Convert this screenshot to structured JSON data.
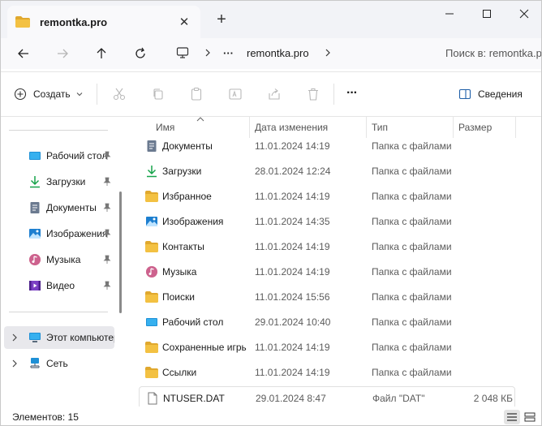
{
  "tab": {
    "title": "remontka.pro",
    "close": "✕"
  },
  "new_tab": "+",
  "window_controls": {
    "minimize": "—",
    "maximize": "☐",
    "close": "✕"
  },
  "breadcrumb": {
    "ellipsis": "···",
    "current": "remontka.pro"
  },
  "search": {
    "placeholder": "Поиск в: remontka.pro"
  },
  "toolbar": {
    "create_label": "Создать",
    "more": "···",
    "details_label": "Сведения"
  },
  "sidebar": {
    "pinned": [
      {
        "label": "Рабочий стол",
        "icon": "desktop-icon"
      },
      {
        "label": "Загрузки",
        "icon": "download-icon"
      },
      {
        "label": "Документы",
        "icon": "documents-icon"
      },
      {
        "label": "Изображения",
        "icon": "pictures-icon"
      },
      {
        "label": "Музыка",
        "icon": "music-icon"
      },
      {
        "label": "Видео",
        "icon": "video-icon"
      }
    ],
    "tree": [
      {
        "label": "Этот компьютер",
        "icon": "this-pc-icon"
      },
      {
        "label": "Сеть",
        "icon": "network-icon"
      }
    ]
  },
  "columns": {
    "name": "Имя",
    "date": "Дата изменения",
    "type": "Тип",
    "size": "Размер"
  },
  "files": [
    {
      "name": "Документы",
      "date": "11.01.2024 14:19",
      "type": "Папка с файлами",
      "size": "",
      "icon": "documents-icon"
    },
    {
      "name": "Загрузки",
      "date": "28.01.2024 12:24",
      "type": "Папка с файлами",
      "size": "",
      "icon": "download-icon"
    },
    {
      "name": "Избранное",
      "date": "11.01.2024 14:19",
      "type": "Папка с файлами",
      "size": "",
      "icon": "folder-icon"
    },
    {
      "name": "Изображения",
      "date": "11.01.2024 14:35",
      "type": "Папка с файлами",
      "size": "",
      "icon": "pictures-icon"
    },
    {
      "name": "Контакты",
      "date": "11.01.2024 14:19",
      "type": "Папка с файлами",
      "size": "",
      "icon": "folder-icon"
    },
    {
      "name": "Музыка",
      "date": "11.01.2024 14:19",
      "type": "Папка с файлами",
      "size": "",
      "icon": "music-icon"
    },
    {
      "name": "Поиски",
      "date": "11.01.2024 15:56",
      "type": "Папка с файлами",
      "size": "",
      "icon": "folder-icon"
    },
    {
      "name": "Рабочий стол",
      "date": "29.01.2024 10:40",
      "type": "Папка с файлами",
      "size": "",
      "icon": "desktop-icon"
    },
    {
      "name": "Сохраненные игры",
      "date": "11.01.2024 14:19",
      "type": "Папка с файлами",
      "size": "",
      "icon": "folder-icon"
    },
    {
      "name": "Ссылки",
      "date": "11.01.2024 14:19",
      "type": "Папка с файлами",
      "size": "",
      "icon": "folder-icon"
    },
    {
      "name": "NTUSER.DAT",
      "date": "29.01.2024 8:47",
      "type": "Файл \"DAT\"",
      "size": "2 048 КБ",
      "icon": "file-icon"
    }
  ],
  "status": {
    "items_count": "Элементов: 15"
  },
  "colors": {
    "folder": "#f3c142",
    "folder_dark": "#e0a82e",
    "accent": "#0067c0",
    "download": "#16a34a"
  }
}
